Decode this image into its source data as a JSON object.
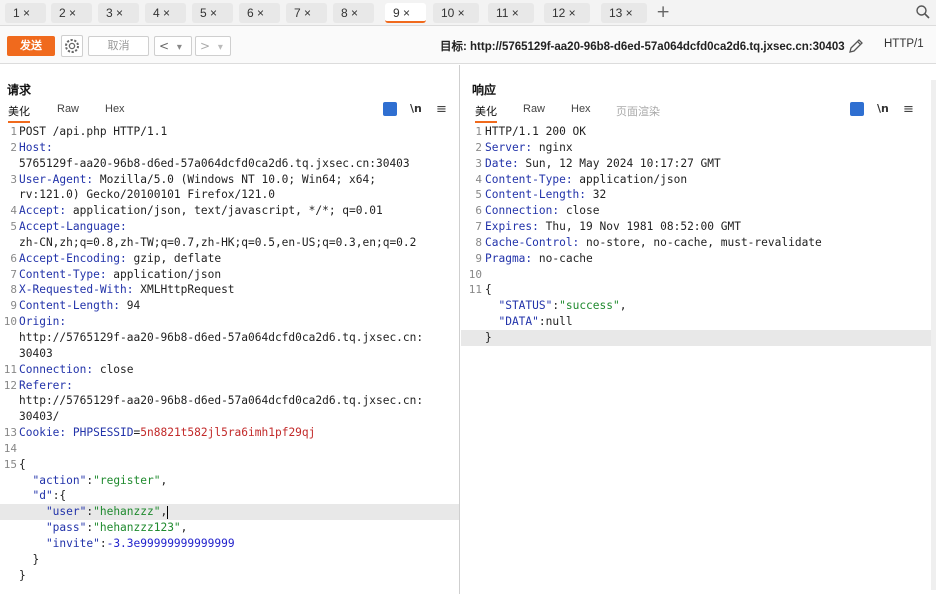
{
  "tabs": [
    {
      "label": "1 ×"
    },
    {
      "label": "2 ×"
    },
    {
      "label": "3 ×"
    },
    {
      "label": "4 ×"
    },
    {
      "label": "5 ×"
    },
    {
      "label": "6 ×"
    },
    {
      "label": "7 ×"
    },
    {
      "label": "8 ×"
    },
    {
      "label": "9 ×"
    },
    {
      "label": "10 ×"
    },
    {
      "label": "11 ×"
    },
    {
      "label": "12 ×"
    },
    {
      "label": "13 ×"
    }
  ],
  "active_tab": "9",
  "toolbar": {
    "send_label": "发送",
    "cancel_label": "取消",
    "back_label": "<",
    "forward_label": ">",
    "dropdown_label": "▾",
    "target": "目标: http://5765129f-aa20-96b8-d6ed-57a064dcfd0ca2d6.tq.jxsec.cn:30403",
    "http_version": "HTTP/1"
  },
  "request": {
    "title": "请求",
    "tabs": [
      "美化",
      "Raw",
      "Hex"
    ],
    "ln_label": "\\n",
    "lines": [
      {
        "n": "1",
        "parts": [
          {
            "t": "POST /api.php HTTP/1.1",
            "c": "v"
          }
        ]
      },
      {
        "n": "2",
        "parts": [
          {
            "t": "Host:",
            "c": "k"
          }
        ]
      },
      {
        "n": "",
        "parts": [
          {
            "t": "5765129f-aa20-96b8-d6ed-57a064dcfd0ca2d6.tq.jxsec.cn:30403",
            "c": "v"
          }
        ]
      },
      {
        "n": "3",
        "parts": [
          {
            "t": "User-Agent:",
            "c": "k"
          },
          {
            "t": " Mozilla/5.0 (Windows NT 10.0; Win64; x64;",
            "c": "v"
          }
        ]
      },
      {
        "n": "",
        "parts": [
          {
            "t": "rv:121.0) Gecko/20100101 Firefox/121.0",
            "c": "v"
          }
        ]
      },
      {
        "n": "4",
        "parts": [
          {
            "t": "Accept:",
            "c": "k"
          },
          {
            "t": " application/json, text/javascript, */*; q=0.01",
            "c": "v"
          }
        ]
      },
      {
        "n": "5",
        "parts": [
          {
            "t": "Accept-Language:",
            "c": "k"
          }
        ]
      },
      {
        "n": "",
        "parts": [
          {
            "t": "zh-CN,zh;q=0.8,zh-TW;q=0.7,zh-HK;q=0.5,en-US;q=0.3,en;q=0.2",
            "c": "v"
          }
        ]
      },
      {
        "n": "6",
        "parts": [
          {
            "t": "Accept-Encoding:",
            "c": "k"
          },
          {
            "t": " gzip, deflate",
            "c": "v"
          }
        ]
      },
      {
        "n": "7",
        "parts": [
          {
            "t": "Content-Type:",
            "c": "k"
          },
          {
            "t": " application/json",
            "c": "v"
          }
        ]
      },
      {
        "n": "8",
        "parts": [
          {
            "t": "X-Requested-With:",
            "c": "k"
          },
          {
            "t": " XMLHttpRequest",
            "c": "v"
          }
        ]
      },
      {
        "n": "9",
        "parts": [
          {
            "t": "Content-Length:",
            "c": "k"
          },
          {
            "t": " 94",
            "c": "v"
          }
        ]
      },
      {
        "n": "10",
        "parts": [
          {
            "t": "Origin:",
            "c": "k"
          }
        ]
      },
      {
        "n": "",
        "parts": [
          {
            "t": "http://5765129f-aa20-96b8-d6ed-57a064dcfd0ca2d6.tq.jxsec.cn:",
            "c": "v"
          }
        ]
      },
      {
        "n": "",
        "parts": [
          {
            "t": "30403",
            "c": "v"
          }
        ]
      },
      {
        "n": "11",
        "parts": [
          {
            "t": "Connection:",
            "c": "k"
          },
          {
            "t": " close",
            "c": "v"
          }
        ]
      },
      {
        "n": "12",
        "parts": [
          {
            "t": "Referer:",
            "c": "k"
          }
        ]
      },
      {
        "n": "",
        "parts": [
          {
            "t": "http://5765129f-aa20-96b8-d6ed-57a064dcfd0ca2d6.tq.jxsec.cn:",
            "c": "v"
          }
        ]
      },
      {
        "n": "",
        "parts": [
          {
            "t": "30403/",
            "c": "v"
          }
        ]
      },
      {
        "n": "13",
        "parts": [
          {
            "t": "Cookie:",
            "c": "k"
          },
          {
            "t": " PHPSESSID",
            "c": "k"
          },
          {
            "t": "=",
            "c": "v"
          },
          {
            "t": "5n8821t582jl5ra6imh1pf29qj",
            "c": "red"
          }
        ]
      },
      {
        "n": "14",
        "parts": []
      },
      {
        "n": "15",
        "parts": [
          {
            "t": "{",
            "c": "v"
          }
        ]
      },
      {
        "n": "",
        "parts": [
          {
            "t": "  \"action\"",
            "c": "k"
          },
          {
            "t": ":",
            "c": "v"
          },
          {
            "t": "\"register\"",
            "c": "s"
          },
          {
            "t": ",",
            "c": "v"
          }
        ]
      },
      {
        "n": "",
        "parts": [
          {
            "t": "  \"d\"",
            "c": "k"
          },
          {
            "t": ":{",
            "c": "v"
          }
        ]
      },
      {
        "n": "",
        "hl": true,
        "cursor": true,
        "parts": [
          {
            "t": "    \"user\"",
            "c": "k"
          },
          {
            "t": ":",
            "c": "v"
          },
          {
            "t": "\"hehanzzz\"",
            "c": "s"
          },
          {
            "t": ",",
            "c": "v"
          }
        ]
      },
      {
        "n": "",
        "parts": [
          {
            "t": "    \"pass\"",
            "c": "k"
          },
          {
            "t": ":",
            "c": "v"
          },
          {
            "t": "\"hehanzzz123\"",
            "c": "s"
          },
          {
            "t": ",",
            "c": "v"
          }
        ]
      },
      {
        "n": "",
        "parts": [
          {
            "t": "    \"invite\"",
            "c": "k"
          },
          {
            "t": ":",
            "c": "v"
          },
          {
            "t": "-3.3e99999999999999",
            "c": "n"
          }
        ]
      },
      {
        "n": "",
        "parts": [
          {
            "t": "  }",
            "c": "v"
          }
        ]
      },
      {
        "n": "",
        "parts": [
          {
            "t": "}",
            "c": "v"
          }
        ]
      }
    ]
  },
  "response": {
    "title": "响应",
    "tabs": [
      "美化",
      "Raw",
      "Hex",
      "页面渲染"
    ],
    "ln_label": "\\n",
    "lines": [
      {
        "n": "1",
        "parts": [
          {
            "t": "HTTP/1.1 200 OK",
            "c": "v"
          }
        ]
      },
      {
        "n": "2",
        "parts": [
          {
            "t": "Server:",
            "c": "k"
          },
          {
            "t": " nginx",
            "c": "v"
          }
        ]
      },
      {
        "n": "3",
        "parts": [
          {
            "t": "Date:",
            "c": "k"
          },
          {
            "t": " Sun, 12 May 2024 10:17:27 GMT",
            "c": "v"
          }
        ]
      },
      {
        "n": "4",
        "parts": [
          {
            "t": "Content-Type:",
            "c": "k"
          },
          {
            "t": " application/json",
            "c": "v"
          }
        ]
      },
      {
        "n": "5",
        "parts": [
          {
            "t": "Content-Length:",
            "c": "k"
          },
          {
            "t": " 32",
            "c": "v"
          }
        ]
      },
      {
        "n": "6",
        "parts": [
          {
            "t": "Connection:",
            "c": "k"
          },
          {
            "t": " close",
            "c": "v"
          }
        ]
      },
      {
        "n": "7",
        "parts": [
          {
            "t": "Expires:",
            "c": "k"
          },
          {
            "t": " Thu, 19 Nov 1981 08:52:00 GMT",
            "c": "v"
          }
        ]
      },
      {
        "n": "8",
        "parts": [
          {
            "t": "Cache-Control:",
            "c": "k"
          },
          {
            "t": " no-store, no-cache, must-revalidate",
            "c": "v"
          }
        ]
      },
      {
        "n": "9",
        "parts": [
          {
            "t": "Pragma:",
            "c": "k"
          },
          {
            "t": " no-cache",
            "c": "v"
          }
        ]
      },
      {
        "n": "10",
        "parts": []
      },
      {
        "n": "11",
        "parts": [
          {
            "t": "{",
            "c": "v"
          }
        ]
      },
      {
        "n": "",
        "parts": [
          {
            "t": "  \"STATUS\"",
            "c": "k"
          },
          {
            "t": ":",
            "c": "v"
          },
          {
            "t": "\"success\"",
            "c": "s"
          },
          {
            "t": ",",
            "c": "v"
          }
        ]
      },
      {
        "n": "",
        "parts": [
          {
            "t": "  \"DATA\"",
            "c": "k"
          },
          {
            "t": ":null",
            "c": "v"
          }
        ]
      },
      {
        "n": "",
        "hl": true,
        "parts": [
          {
            "t": "}",
            "c": "v"
          }
        ]
      }
    ]
  },
  "colors": {
    "accent": "#f06a1d",
    "header_key": "#2233aa",
    "string": "#1f8a2e",
    "number": "#2222cc",
    "cookie_value": "#c22a2a"
  }
}
